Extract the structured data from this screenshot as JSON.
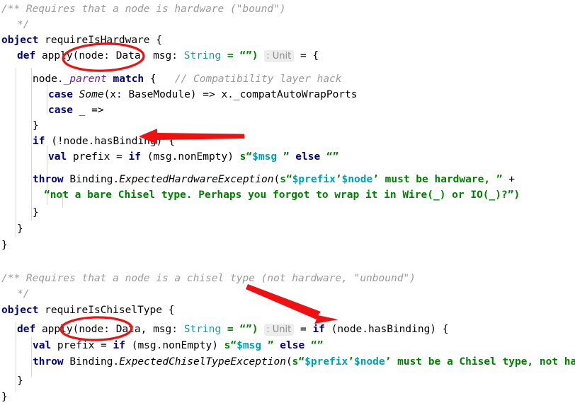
{
  "editor": {
    "language": "Scala",
    "background": "#ffffff",
    "colors": {
      "keyword": "#000080",
      "comment": "#9a9a9a",
      "string": "#008000",
      "interpolation": "#00a0b0",
      "type": "#20999d",
      "inlay_background": "#ededed",
      "inlay_text": "#8c8c8c",
      "annotation": "#ee1111",
      "indent_guide": "#d8d8d8"
    }
  },
  "code": {
    "block_one": {
      "doc_comment_open": "/** Requires that a node is hardware (\"bound\")",
      "doc_comment_close": "*/",
      "object_keyword": "object",
      "object_name": "requireIsHardware",
      "object_brace": "{",
      "def_keyword": "def",
      "def_name": "apply",
      "def_params": "(node: Data, msg: ",
      "def_param_type": "String",
      "def_default": " = “”)",
      "inlay_hint": ": Unit",
      "def_tail": " = {",
      "match_expr": "node._parent match {",
      "match_comment": "// Compatibility layer hack",
      "case_keyword": "case",
      "case_one": "Some(x: BaseModule) => x._compatAutoWrapPorts",
      "case_two": "_ =>",
      "close_brace_1": "}",
      "if_keyword": "if",
      "if_cond": "(!node.hasBinding) {",
      "val_keyword": "val",
      "val_name": " prefix = ",
      "val_if": "if",
      "val_cond": " (msg.nonEmpty) ",
      "val_s": "s",
      "val_str_open": "“",
      "val_interp": "$msg",
      "val_str_close": " ” ",
      "val_else": "else",
      "val_empty": " “”",
      "throw_keyword": "throw",
      "throw_obj": " Binding.",
      "throw_exc": "ExpectedHardwareException",
      "throw_open": "(",
      "throw_s": "s",
      "throw_q1": "“",
      "throw_p1": "$prefix",
      "throw_tick1": "’",
      "throw_p2": "$node",
      "throw_tick2": "’",
      "throw_msg": " must be hardware, ",
      "throw_q2": "”",
      "throw_plus": " +",
      "cont_string": "“not a bare Chisel type. Perhaps you forgot to wrap it in Wire(_) or IO(_)?”)",
      "close_brace_2": "}",
      "close_brace_3": "}",
      "close_brace_4": "}"
    },
    "block_two": {
      "doc_comment_open": "/** Requires that a node is a chisel type (not hardware, \"unbound\")",
      "doc_comment_close": "*/",
      "object_keyword": "object",
      "object_name": "requireIsChiselType",
      "object_brace": "{",
      "def_keyword": "def",
      "def_name": "apply",
      "def_params": "(node: Data, msg: ",
      "def_param_type": "String",
      "def_default": " = “”)",
      "inlay_hint": ": Unit",
      "def_tail_eq": " = ",
      "def_tail_if": "if",
      "def_tail_cond": " (node.hasBinding) {",
      "val_keyword": "val",
      "val_name": " prefix = ",
      "val_if": "if",
      "val_cond": " (msg.nonEmpty) ",
      "val_s": "s",
      "val_str_open": "“",
      "val_interp": "$msg",
      "val_str_close": " ” ",
      "val_else": "else",
      "val_empty": " “”",
      "throw_keyword": "throw",
      "throw_obj": " Binding.",
      "throw_exc": "ExpectedChiselTypeException",
      "throw_open": "(",
      "throw_s": "s",
      "throw_q1": "“",
      "throw_p1": "$prefix",
      "throw_tick1": "’",
      "throw_p2": "$node",
      "throw_tick2": "’",
      "throw_msg": " must be a Chisel type, not hardware",
      "throw_q2": "”)",
      "close_brace_1": "}",
      "close_brace_2": "}"
    }
  },
  "annotations": {
    "color": "#ee1111",
    "ellipse_one": {
      "label": "node: Data parameter highlight (requireIsHardware)"
    },
    "ellipse_two": {
      "label": "node: Data parameter highlight (requireIsChiselType)"
    },
    "arrow_one": {
      "label": "arrow pointing to if (!node.hasBinding)"
    },
    "arrow_two": {
      "label": "arrow pointing to if (node.hasBinding)"
    }
  }
}
